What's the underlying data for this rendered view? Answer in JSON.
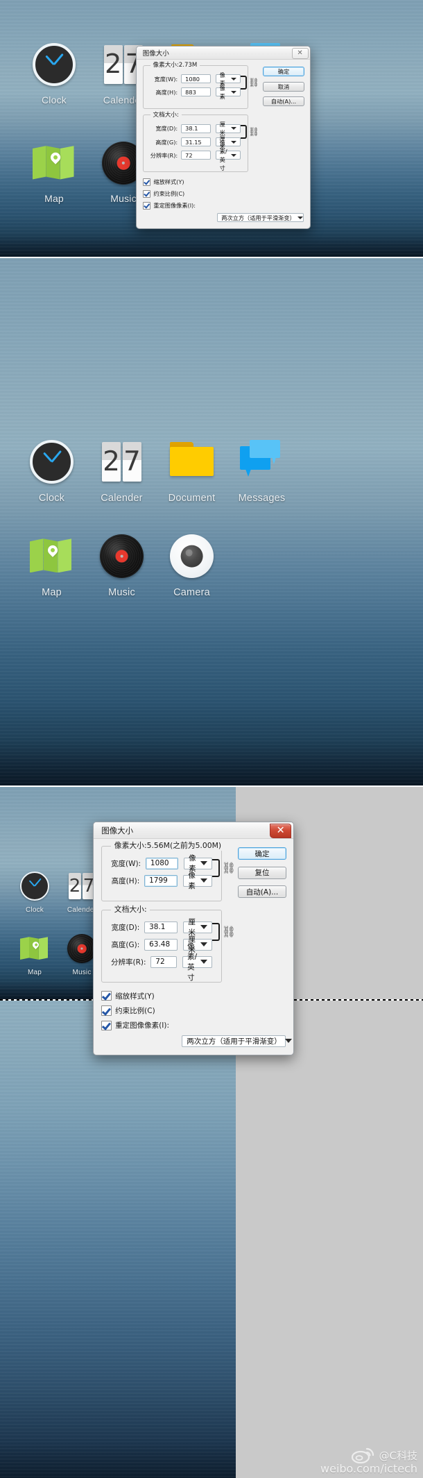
{
  "desktop": {
    "icons_row1": [
      {
        "label": "Clock",
        "icon": "clock-icon"
      },
      {
        "label": "Calender",
        "icon": "calendar-icon",
        "day_tens": "2",
        "day_ones": "7"
      },
      {
        "label": "Document",
        "icon": "folder-icon"
      },
      {
        "label": "Messages",
        "icon": "messages-icon"
      }
    ],
    "icons_row2": [
      {
        "label": "Map",
        "icon": "map-pin-icon"
      },
      {
        "label": "Music",
        "icon": "vinyl-record-icon"
      },
      {
        "label": "Camera",
        "icon": "camera-lens-icon"
      }
    ]
  },
  "dialog_top": {
    "title": "图像大小",
    "close_label": "✕",
    "pixel_group": {
      "legend": "像素大小:2.73M",
      "width_label": "宽度(W):",
      "width_value": "1080",
      "width_unit": "像素",
      "height_label": "高度(H):",
      "height_value": "883",
      "height_unit": "像素"
    },
    "doc_group": {
      "legend": "文档大小:",
      "width_label": "宽度(D):",
      "width_value": "38.1",
      "width_unit": "厘米",
      "height_label": "高度(G):",
      "height_value": "31.15",
      "height_unit": "厘米",
      "res_label": "分辨率(R):",
      "res_value": "72",
      "res_unit": "像素/英寸"
    },
    "checkboxes": [
      {
        "label": "缩放样式(Y)",
        "checked": true
      },
      {
        "label": "约束比例(C)",
        "checked": true
      },
      {
        "label": "重定图像像素(I):",
        "checked": true
      }
    ],
    "resample_value": "两次立方（适用于平滑渐变）",
    "buttons": [
      {
        "label": "确定",
        "primary": true
      },
      {
        "label": "取消",
        "primary": false
      },
      {
        "label": "自动(A)...",
        "primary": false
      }
    ]
  },
  "dialog_bottom": {
    "title": "图像大小",
    "close_label": "✕",
    "pixel_group": {
      "legend": "像素大小:5.56M(之前为5.00M)",
      "width_label": "宽度(W):",
      "width_value": "1080",
      "width_unit": "像素",
      "height_label": "高度(H):",
      "height_value": "1799",
      "height_unit": "像素"
    },
    "doc_group": {
      "legend": "文档大小:",
      "width_label": "宽度(D):",
      "width_value": "38.1",
      "width_unit": "厘米",
      "height_label": "高度(G):",
      "height_value": "63.48",
      "height_unit": "厘米",
      "res_label": "分辨率(R):",
      "res_value": "72",
      "res_unit": "像素/英寸"
    },
    "checkboxes": [
      {
        "label": "缩放样式(Y)",
        "checked": true
      },
      {
        "label": "约束比例(C)",
        "checked": true
      },
      {
        "label": "重定图像像素(I):",
        "checked": true
      }
    ],
    "resample_value": "两次立方（适用于平滑渐变）",
    "buttons": [
      {
        "label": "确定",
        "primary": true
      },
      {
        "label": "复位",
        "primary": false
      },
      {
        "label": "自动(A)...",
        "primary": false
      }
    ]
  },
  "watermark": {
    "handle": "@C科技",
    "url": "weibo.com/ictech",
    "logo": "weibo-logo-icon"
  },
  "colors": {
    "accent_blue": "#29a7ef",
    "folder_yellow": "#ffcc00",
    "map_green": "#9bd24a",
    "vinyl_red": "#e8392e",
    "close_red": "#cf4a35",
    "wallpaper_top": "#7fa0b4",
    "wallpaper_bottom": "#0a1724",
    "canvas_gray": "#c9c9c9"
  }
}
